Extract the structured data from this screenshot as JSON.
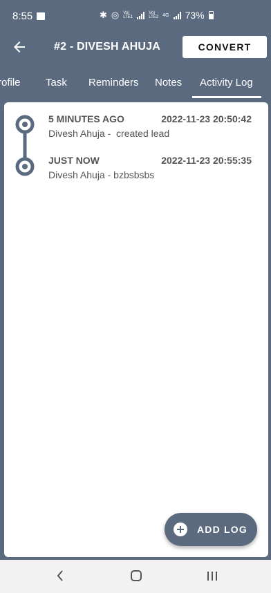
{
  "status_bar": {
    "time": "8:55",
    "sim1": "Vo)\nLTE1",
    "sim2": "Vo)\nLTE2",
    "network": "4G",
    "battery": "73%"
  },
  "toolbar": {
    "title": "#2 - DIVESH AHUJA",
    "convert_label": "CONVERT"
  },
  "tabs": [
    {
      "label": "Profile",
      "active": false
    },
    {
      "label": "Task",
      "active": false
    },
    {
      "label": "Reminders",
      "active": false
    },
    {
      "label": "Notes",
      "active": false
    },
    {
      "label": "Activity Log",
      "active": true
    }
  ],
  "activity_log": [
    {
      "relative_time": "5 MINUTES AGO",
      "datetime": "2022-11-23 20:50:42",
      "description": "Divesh Ahuja -  created lead"
    },
    {
      "relative_time": "JUST NOW",
      "datetime": "2022-11-23 20:55:35",
      "description": "Divesh Ahuja - bzbsbsbs"
    }
  ],
  "fab": {
    "label": "ADD LOG"
  },
  "colors": {
    "primary": "#5b6a7e",
    "text": "#555555",
    "surface": "#ffffff"
  }
}
